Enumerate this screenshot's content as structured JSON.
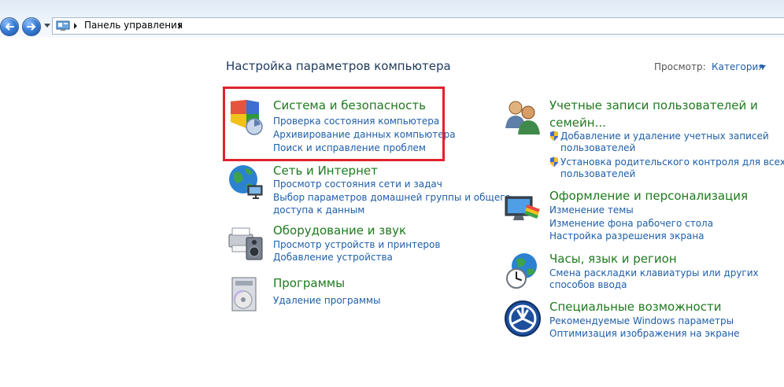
{
  "address": {
    "breadcrumb": "Панель управления"
  },
  "header": {
    "title": "Настройка параметров компьютера",
    "view_label": "Просмотр:",
    "view_value": "Категория"
  },
  "categories": {
    "system": {
      "title": "Система и безопасность",
      "links": [
        "Проверка состояния компьютера",
        "Архивирование данных компьютера",
        "Поиск и исправление проблем"
      ]
    },
    "network": {
      "title": "Сеть и Интернет",
      "links": [
        "Просмотр состояния сети и задач",
        "Выбор параметров домашней группы и общего",
        "доступа к данным"
      ]
    },
    "hardware": {
      "title": "Оборудование и звук",
      "links": [
        "Просмотр устройств и принтеров",
        "Добавление устройства"
      ]
    },
    "programs": {
      "title": "Программы",
      "links": [
        "Удаление программы"
      ]
    },
    "accounts": {
      "title_line1": "Учетные записи пользователей и",
      "title_line2": "семейн...",
      "links": [
        "Добавление и удаление учетных записей",
        "пользователей",
        "Установка родительского контроля для всех",
        "пользователей"
      ]
    },
    "appearance": {
      "title": "Оформление и персонализация",
      "links": [
        "Изменение темы",
        "Изменение фона рабочего стола",
        "Настройка разрешения экрана"
      ]
    },
    "clock": {
      "title": "Часы, язык и регион",
      "links": [
        "Смена раскладки клавиатуры или других",
        "способов ввода"
      ]
    },
    "access": {
      "title": "Специальные возможности",
      "links": [
        "Рекомендуемые Windows параметры",
        "Оптимизация изображения на экране"
      ]
    }
  },
  "colors": {
    "title_green": "#1e7a1e",
    "link_blue": "#1e5ea8",
    "highlight_red": "#e0232b"
  }
}
